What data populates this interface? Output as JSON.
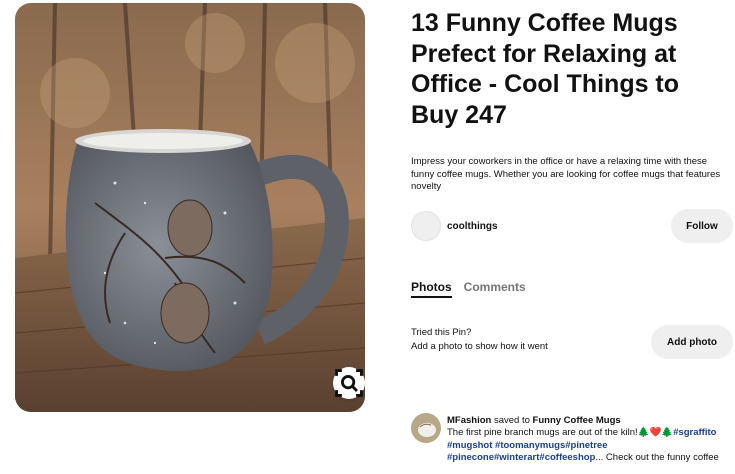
{
  "pin": {
    "title": "13 Funny Coffee Mugs Prefect for Relaxing at Office - Cool Things to Buy 247",
    "description": "Impress your coworkers in the office or have a relaxing time with these funny coffee mugs. Whether you are looking for coffee mugs that features novelty",
    "image_alt": "Grey ceramic mug with carved pine branch and pinecones on a wooden railing",
    "lens_icon": "visual-search-icon"
  },
  "creator": {
    "name": "coolthings",
    "follow_label": "Follow"
  },
  "tabs": [
    {
      "label": "Photos",
      "active": true
    },
    {
      "label": "Comments",
      "active": false
    }
  ],
  "tried": {
    "title": "Tried this Pin?",
    "subtitle": "Add a photo to show how it went",
    "button_label": "Add photo"
  },
  "activity": {
    "user": "MFashion",
    "action": " saved to ",
    "board": "Funny Coffee Mugs",
    "text_start": "The first pine branch mugs are out of the kiln!",
    "emoji": "🌲❤️🌲",
    "hashtags_line1": [
      "#sgraffito"
    ],
    "hashtags_line2": [
      "#mugshot",
      "#toomanymugs",
      "#pinetree"
    ],
    "hashtags_line3": [
      "#pinecone",
      "#winterart",
      "#coffeeshop"
    ],
    "ellipsis": "...",
    "trailing": " Check out the funny coffee"
  },
  "colors": {
    "background": "#ffffff",
    "button_bg": "#efefef",
    "hashtag": "#1b3f8f",
    "inactive_tab": "#767676"
  }
}
